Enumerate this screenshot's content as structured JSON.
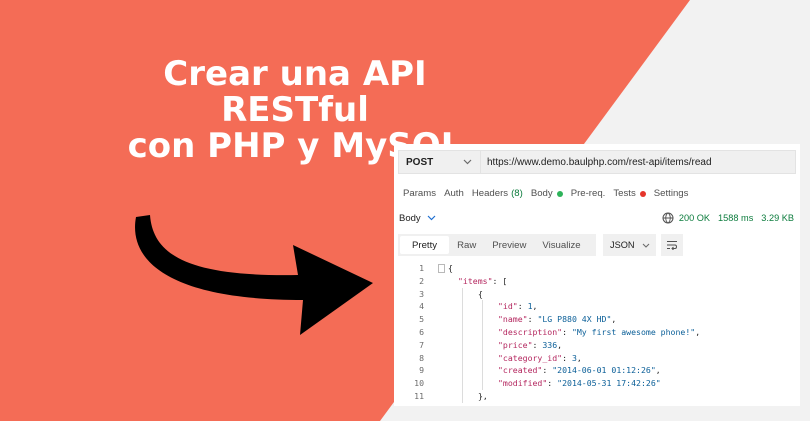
{
  "colors": {
    "coral": "#f46c56",
    "light_bg": "#f2f2f2",
    "arrow": "#000000",
    "ok_green": "#0c7c3d",
    "body_dot": "#2eb35a",
    "tests_dot": "#e5352b",
    "json_key": "#b4275f",
    "json_value": "#0b5f98"
  },
  "headline": {
    "line1": "Crear una API RESTful",
    "line2": "con PHP y MySQL"
  },
  "request": {
    "method": "POST",
    "url": "https://www.demo.baulphp.com/rest-api/items/read"
  },
  "request_tabs": [
    {
      "label": "Params"
    },
    {
      "label": "Auth"
    },
    {
      "label": "Headers",
      "count": "(8)"
    },
    {
      "label": "Body",
      "indicator": "green-dot"
    },
    {
      "label": "Pre-req."
    },
    {
      "label": "Tests",
      "indicator": "red-dot"
    },
    {
      "label": "Settings"
    }
  ],
  "response": {
    "body_label": "Body",
    "status": "200 OK",
    "time": "1588 ms",
    "size": "3.29 KB"
  },
  "view_tabs": [
    "Pretty",
    "Raw",
    "Preview",
    "Visualize"
  ],
  "format_select": "JSON",
  "icons": [
    "chevron-down-icon",
    "globe-icon",
    "wrap-lines-icon",
    "fold-icon",
    "arrow-icon"
  ],
  "code_lines": [
    {
      "num": "1",
      "indent": 0,
      "parts": [
        [
          "p",
          "{"
        ]
      ]
    },
    {
      "num": "2",
      "indent": 1,
      "parts": [
        [
          "k",
          "\"items\""
        ],
        [
          "p",
          ": ["
        ]
      ]
    },
    {
      "num": "3",
      "indent": 2,
      "parts": [
        [
          "p",
          "{"
        ]
      ]
    },
    {
      "num": "4",
      "indent": 3,
      "parts": [
        [
          "k",
          "\"id\""
        ],
        [
          "p",
          ": "
        ],
        [
          "n",
          "1"
        ],
        [
          "p",
          ","
        ]
      ]
    },
    {
      "num": "5",
      "indent": 3,
      "parts": [
        [
          "k",
          "\"name\""
        ],
        [
          "p",
          ": "
        ],
        [
          "s",
          "\"LG P880 4X HD\""
        ],
        [
          "p",
          ","
        ]
      ]
    },
    {
      "num": "6",
      "indent": 3,
      "parts": [
        [
          "k",
          "\"description\""
        ],
        [
          "p",
          ": "
        ],
        [
          "s",
          "\"My first awesome phone!\""
        ],
        [
          "p",
          ","
        ]
      ]
    },
    {
      "num": "7",
      "indent": 3,
      "parts": [
        [
          "k",
          "\"price\""
        ],
        [
          "p",
          ": "
        ],
        [
          "n",
          "336"
        ],
        [
          "p",
          ","
        ]
      ]
    },
    {
      "num": "8",
      "indent": 3,
      "parts": [
        [
          "k",
          "\"category_id\""
        ],
        [
          "p",
          ": "
        ],
        [
          "n",
          "3"
        ],
        [
          "p",
          ","
        ]
      ]
    },
    {
      "num": "9",
      "indent": 3,
      "parts": [
        [
          "k",
          "\"created\""
        ],
        [
          "p",
          ": "
        ],
        [
          "s",
          "\"2014-06-01 01:12:26\""
        ],
        [
          "p",
          ","
        ]
      ]
    },
    {
      "num": "10",
      "indent": 3,
      "parts": [
        [
          "k",
          "\"modified\""
        ],
        [
          "p",
          ": "
        ],
        [
          "s",
          "\"2014-05-31 17:42:26\""
        ]
      ]
    },
    {
      "num": "11",
      "indent": 2,
      "parts": [
        [
          "p",
          "},"
        ]
      ]
    }
  ]
}
